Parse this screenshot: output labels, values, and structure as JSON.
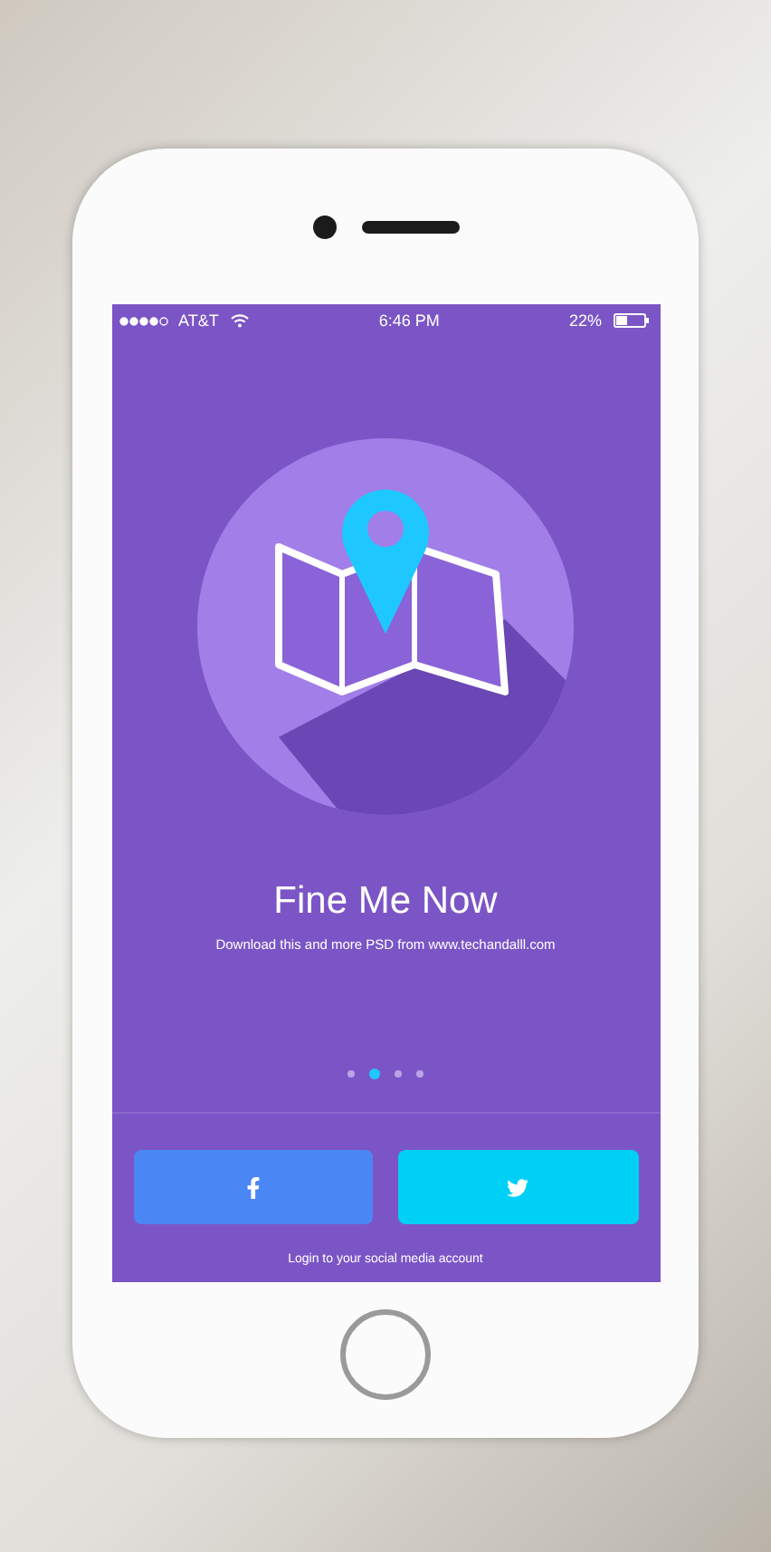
{
  "status_bar": {
    "carrier": "AT&T",
    "time": "6:46 PM",
    "battery": "22%"
  },
  "onboarding": {
    "title": "Fine Me Now",
    "subtitle": "Download this and more PSD from www.techandalll.com"
  },
  "pager": [
    {
      "selected": false
    },
    {
      "selected": true
    },
    {
      "selected": false
    },
    {
      "selected": false
    }
  ],
  "social_buttons": [
    {
      "kind": "facebook"
    },
    {
      "kind": "twitter"
    }
  ],
  "footer_text": "Login to your social media account"
}
